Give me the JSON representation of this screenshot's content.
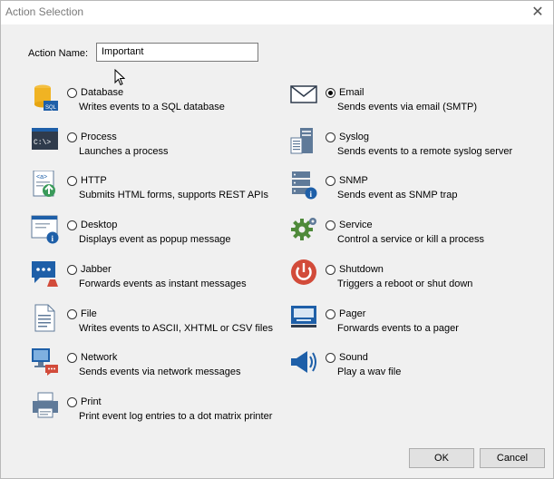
{
  "window": {
    "title": "Action Selection",
    "close_glyph": "✕"
  },
  "action_name": {
    "label": "Action Name:",
    "value": "Important"
  },
  "options": [
    {
      "id": "database",
      "label": "Database",
      "desc": "Writes events to a SQL database",
      "icon": "database-icon",
      "checked": false
    },
    {
      "id": "process",
      "label": "Process",
      "desc": "Launches a process",
      "icon": "console-icon",
      "checked": false
    },
    {
      "id": "http",
      "label": "HTTP",
      "desc": "Submits HTML forms, supports REST APIs",
      "icon": "http-icon",
      "checked": false
    },
    {
      "id": "desktop",
      "label": "Desktop",
      "desc": "Displays event as popup message",
      "icon": "desktop-popup-icon",
      "checked": false
    },
    {
      "id": "jabber",
      "label": "Jabber",
      "desc": "Forwards events as instant messages",
      "icon": "chat-icon",
      "checked": false
    },
    {
      "id": "file",
      "label": "File",
      "desc": "Writes events to ASCII, XHTML or CSV files",
      "icon": "file-icon",
      "checked": false
    },
    {
      "id": "network",
      "label": "Network",
      "desc": "Sends events via network messages",
      "icon": "network-icon",
      "checked": false
    },
    {
      "id": "print",
      "label": "Print",
      "desc": "Print event log entries to a dot matrix printer",
      "icon": "printer-icon",
      "checked": false
    },
    {
      "id": "email",
      "label": "Email",
      "desc": "Sends events via email (SMTP)",
      "icon": "envelope-icon",
      "checked": true
    },
    {
      "id": "syslog",
      "label": "Syslog",
      "desc": "Sends events to a remote syslog server",
      "icon": "server-icon",
      "checked": false
    },
    {
      "id": "snmp",
      "label": "SNMP",
      "desc": "Sends event as SNMP trap",
      "icon": "snmp-server-icon",
      "checked": false
    },
    {
      "id": "service",
      "label": "Service",
      "desc": "Control a service or kill a process",
      "icon": "gear-icon",
      "checked": false
    },
    {
      "id": "shutdown",
      "label": "Shutdown",
      "desc": "Triggers a reboot or shut down",
      "icon": "power-icon",
      "checked": false
    },
    {
      "id": "pager",
      "label": "Pager",
      "desc": "Forwards events to a pager",
      "icon": "pager-icon",
      "checked": false
    },
    {
      "id": "sound",
      "label": "Sound",
      "desc": "Play a wav file",
      "icon": "speaker-icon",
      "checked": false
    }
  ],
  "buttons": {
    "ok": "OK",
    "cancel": "Cancel"
  },
  "colors": {
    "accent": "#1e5fa8",
    "red": "#d24b3a",
    "green": "#4f8a3a"
  }
}
